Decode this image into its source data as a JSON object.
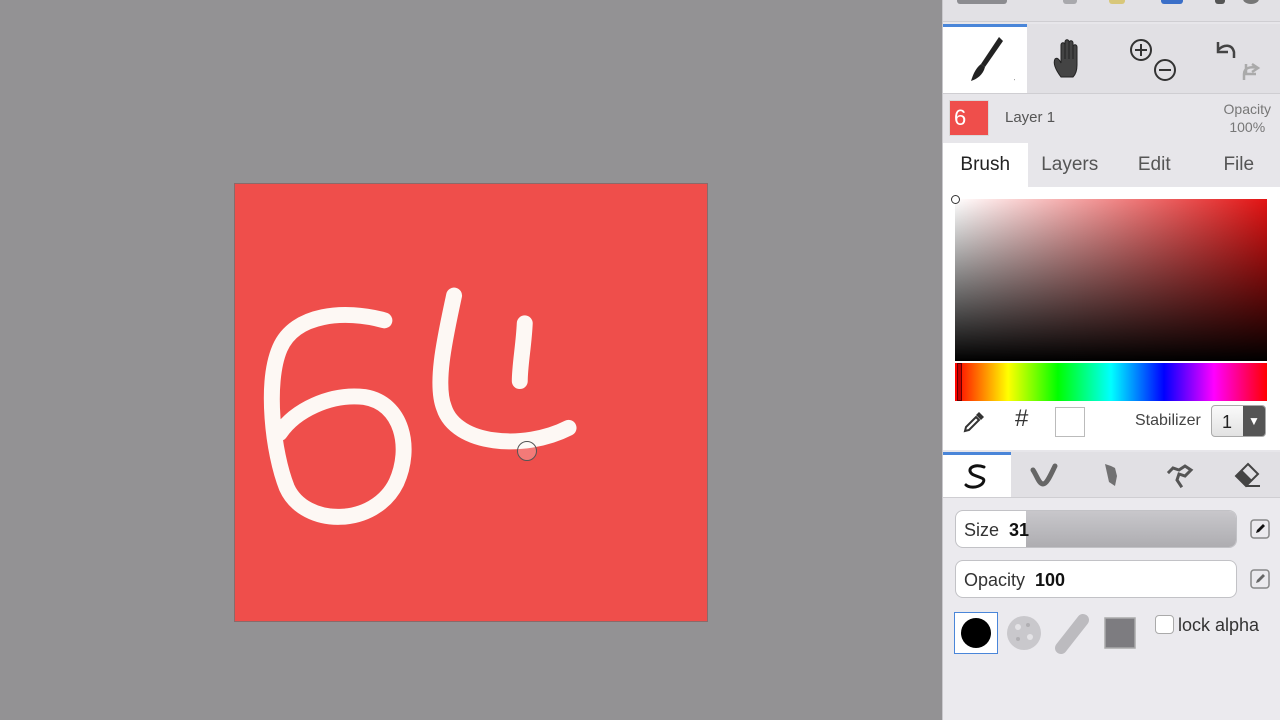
{
  "document": {
    "layer_name": "Layer 1",
    "layer_thumb_text": "6",
    "opacity_label": "Opacity",
    "opacity_value": "100%"
  },
  "tabs": [
    "Brush",
    "Layers",
    "Edit",
    "File"
  ],
  "color": {
    "hex_symbol": "#",
    "current": "#ffffff",
    "canvas_fill": "#ef4e4b"
  },
  "stabilizer": {
    "label": "Stabilizer",
    "value": "1",
    "arrow": "▼"
  },
  "brush": {
    "size_label": "Size",
    "size_value": "31",
    "size_fraction": 0.1,
    "opacity_label": "Opacity",
    "opacity_value": "100",
    "opacity_fraction": 1.0,
    "lock_alpha_label": "lock alpha"
  },
  "accent": "#4a86d9"
}
